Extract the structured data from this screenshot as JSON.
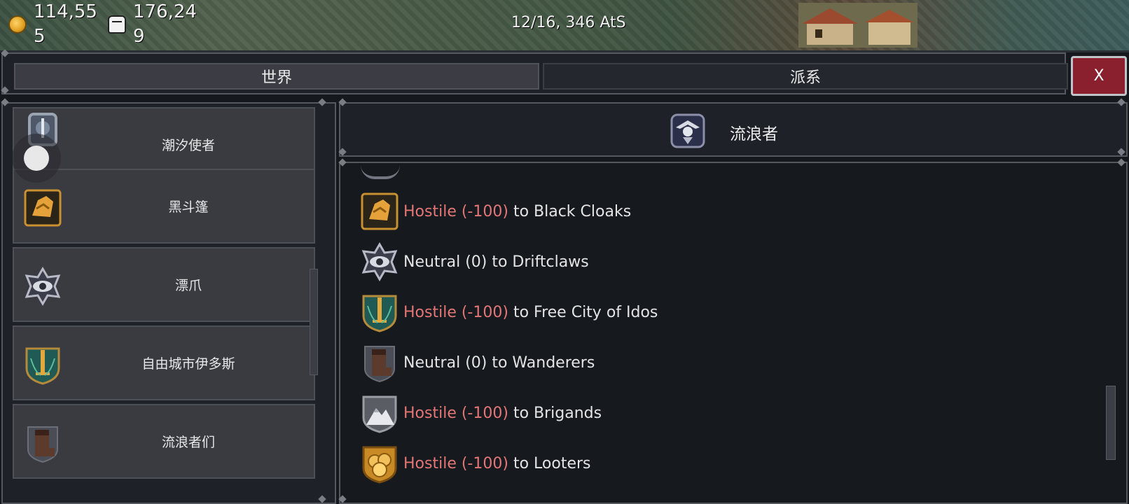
{
  "topbar": {
    "gold": "114,555",
    "manpower": "176,249",
    "date": "12/16, 346 AtS"
  },
  "tabs": [
    {
      "label": "世界",
      "active": true
    },
    {
      "label": "派系",
      "active": false
    }
  ],
  "close_label": "X",
  "factions": [
    {
      "name": "潮汐使者",
      "icon": "tide-emblem-icon"
    },
    {
      "name": "黑斗篷",
      "icon": "black-cloak-emblem-icon"
    },
    {
      "name": "漂爪",
      "icon": "eye-emblem-icon"
    },
    {
      "name": "自由城市伊多斯",
      "icon": "sword-shield-emblem-icon"
    },
    {
      "name": "流浪者们",
      "icon": "boot-emblem-icon"
    }
  ],
  "selected_faction": {
    "name": "流浪者",
    "icon": "wanderer-emblem-icon"
  },
  "relations": [
    {
      "status": "Hostile (-100)",
      "target": " to Black Cloaks",
      "hostile": true,
      "icon": "black-cloak-emblem-icon"
    },
    {
      "status": "Neutral (0)",
      "target": " to Driftclaws",
      "hostile": false,
      "icon": "eye-emblem-icon"
    },
    {
      "status": "Hostile (-100)",
      "target": " to Free City of Idos",
      "hostile": true,
      "icon": "sword-shield-emblem-icon"
    },
    {
      "status": "Neutral (0)",
      "target": " to Wanderers",
      "hostile": false,
      "icon": "boot-emblem-icon"
    },
    {
      "status": "Hostile (-100)",
      "target": " to Brigands",
      "hostile": true,
      "icon": "mountain-emblem-icon"
    },
    {
      "status": "Hostile (-100)",
      "target": " to Looters",
      "hostile": true,
      "icon": "coin-pile-emblem-icon"
    }
  ],
  "colors": {
    "hostile": "#e37676",
    "close_button": "#8a1f2e",
    "panel": "#1e2127"
  }
}
